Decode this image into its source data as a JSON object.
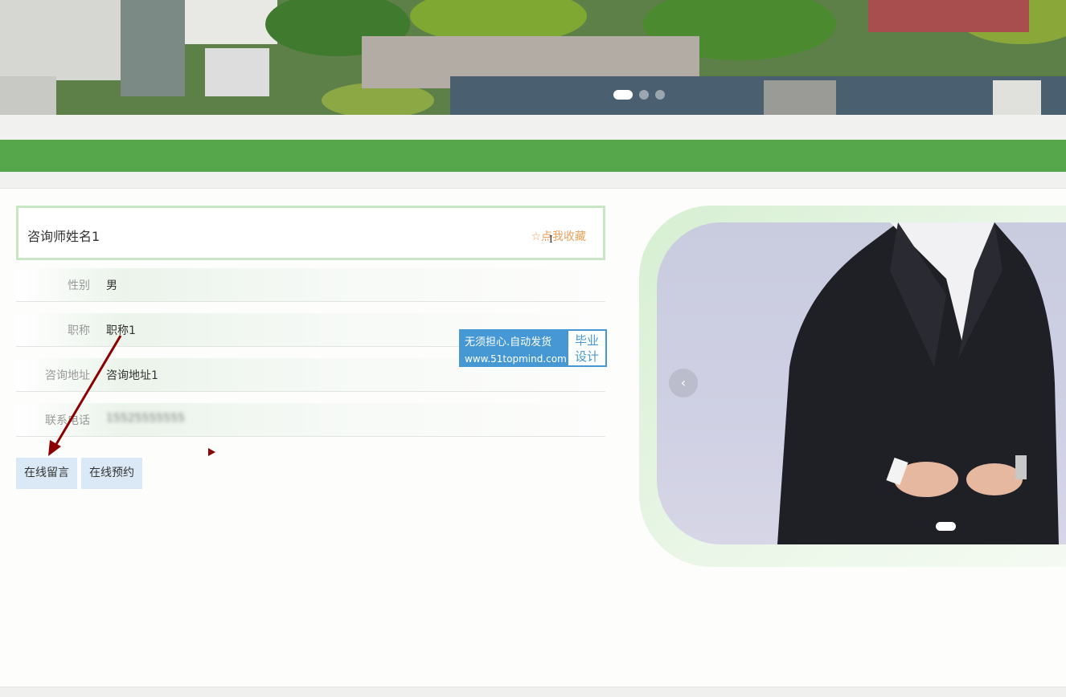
{
  "banner": {
    "slides": 3,
    "active_slide": 1
  },
  "detail": {
    "name": "咨询师姓名1",
    "favorite_label": "☆点我收藏",
    "fields": [
      {
        "label": "性别",
        "value": "男"
      },
      {
        "label": "职称",
        "value": "职称1"
      },
      {
        "label": "咨询地址",
        "value": "咨询地址1"
      },
      {
        "label": "联系电话",
        "value": "15525555555"
      }
    ]
  },
  "actions": {
    "message_label": "在线留言",
    "booking_label": "在线预约"
  },
  "watermark": {
    "line1": "无须担心.自动发货",
    "line2": "www.51topmind.com",
    "right_top": "毕业",
    "right_bottom": "设计"
  },
  "carousel": {
    "prev_label": "‹",
    "slides": 1
  },
  "colors": {
    "green_bar": "#56a64c",
    "favorite_text": "#e8a15a",
    "button_bg": "#dbe9f6",
    "watermark_blue": "#4698d5",
    "annotation_arrow": "#8b0000"
  }
}
